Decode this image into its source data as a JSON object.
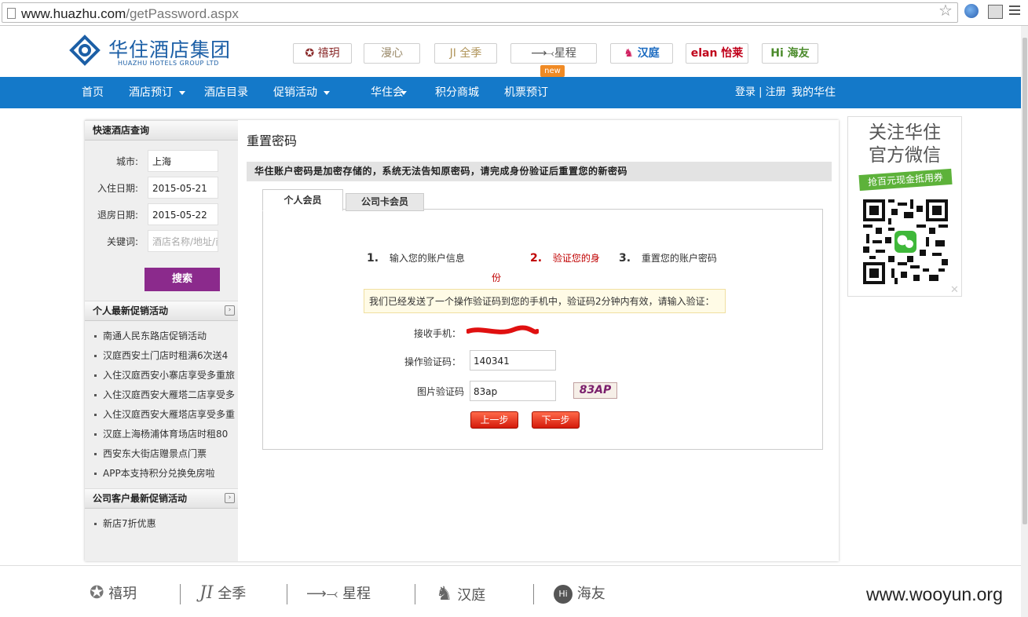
{
  "browser": {
    "url_host": "www.huazhu.com",
    "url_path": "/getPassword.aspx"
  },
  "header": {
    "logo_title": "华住酒店集团",
    "logo_subtitle": "HUAZHU HOTELS GROUP LTD",
    "brands": [
      {
        "label": "✪ 禧玥",
        "color": "#8a2a2a"
      },
      {
        "label": "漫心",
        "color": "#9a8a6a"
      },
      {
        "label": "JI 全季",
        "color": "#b0945a"
      },
      {
        "label": "星程",
        "color": "#555555"
      },
      {
        "label": "汉庭",
        "color": "#1a6ac0"
      },
      {
        "label": "elan 怡莱",
        "color": "#c0001a"
      },
      {
        "label": "Hi 海友",
        "color": "#4a8a2a"
      }
    ],
    "new_badge": "new"
  },
  "nav": {
    "items": [
      "首页",
      "酒店预订",
      "酒店目录",
      "促销活动",
      "华住会",
      "积分商城",
      "机票预订"
    ],
    "login": "登录 | 注册",
    "my": "我的华住"
  },
  "sidebar": {
    "quick_title": "快速酒店查询",
    "fields": [
      {
        "label": "城市:",
        "value": "上海"
      },
      {
        "label": "入住日期:",
        "value": "2015-05-21"
      },
      {
        "label": "退房日期:",
        "value": "2015-05-22"
      },
      {
        "label": "关键词:",
        "placeholder": "酒店名称/地址/商"
      }
    ],
    "search_label": "搜索",
    "personal_title": "个人最新促销活动",
    "personal_promos": [
      "南通人民东路店促销活动",
      "汉庭西安土门店时租满6次送4",
      "入住汉庭西安小寨店享受多重旅",
      "入住汉庭西安大雁塔二店享受多",
      "入住汉庭西安大雁塔店享受多重",
      "汉庭上海杨浦体育场店时租80",
      "西安东大街店赠景点门票",
      "APP本支持积分兑换免房啦"
    ],
    "corp_title": "公司客户最新促销活动",
    "corp_promos": [
      "新店7折优惠"
    ],
    "more_icon": "›"
  },
  "main": {
    "title": "重置密码",
    "notice": "华住账户密码是加密存储的，系统无法告知原密码，请完成身份验证后重置您的新密码",
    "tabs": [
      "个人会员",
      "公司卡会员"
    ],
    "steps": [
      {
        "num": "1.",
        "text": "输入您的账户信息"
      },
      {
        "num": "2.",
        "text": "验证您的身",
        "text2": "份"
      },
      {
        "num": "3.",
        "text": "重置您的账户密码"
      }
    ],
    "code_notice": "我们已经发送了一个操作验证码到您的手机中，验证码2分钟内有效，请输入验证：",
    "phone_label": "接收手机：",
    "opcode_label": "操作验证码：",
    "opcode_value": "140341",
    "captcha_label": "图片验证码",
    "captcha_value": "83ap",
    "captcha_image_text": "83AP",
    "prev_button": "上一步",
    "next_button": "下一步"
  },
  "wechat": {
    "title_line1": "关注华住",
    "title_line2": "官方微信",
    "ribbon": "抢百元现金抵用券",
    "close": "✕"
  },
  "footer": {
    "brands": [
      "禧玥",
      "全季",
      "星程",
      "汉庭",
      "海友"
    ],
    "watermark": "www.wooyun.org"
  }
}
